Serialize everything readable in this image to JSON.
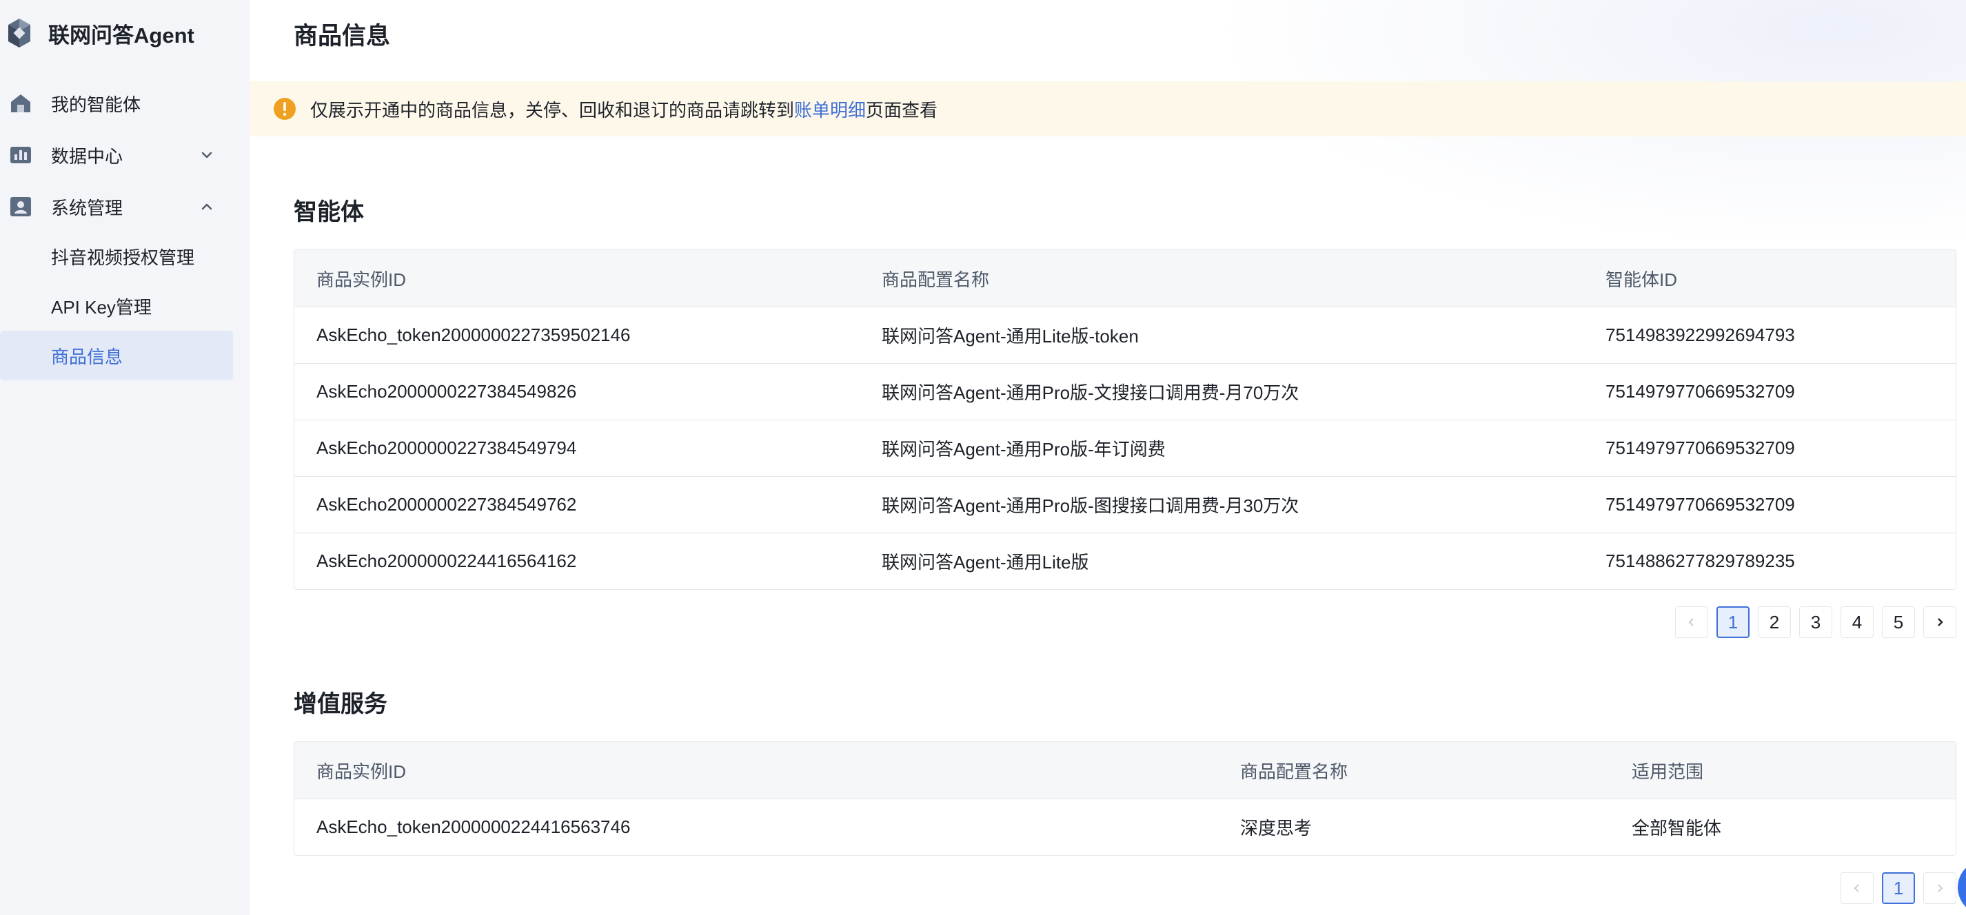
{
  "sidebar": {
    "brand": "联网问答Agent",
    "items": [
      {
        "label": "我的智能体",
        "icon": "home-icon"
      },
      {
        "label": "数据中心",
        "icon": "chart-icon"
      },
      {
        "label": "系统管理",
        "icon": "user-card-icon"
      }
    ],
    "sub_items": [
      {
        "label": "抖音视频授权管理"
      },
      {
        "label": "API Key管理"
      },
      {
        "label": "商品信息"
      }
    ]
  },
  "main": {
    "title": "商品信息",
    "notice": {
      "prefix": "仅展示开通中的商品信息，关停、回收和退订的商品请跳转到",
      "link": "账单明细",
      "suffix": "页面查看"
    },
    "agents": {
      "title": "智能体",
      "columns": [
        "商品实例ID",
        "商品配置名称",
        "智能体ID"
      ],
      "rows": [
        [
          "AskEcho_token2000000227359502146",
          "联网问答Agent-通用Lite版-token",
          "7514983922992694793"
        ],
        [
          "AskEcho2000000227384549826",
          "联网问答Agent-通用Pro版-文搜接口调用费-月70万次",
          "7514979770669532709"
        ],
        [
          "AskEcho2000000227384549794",
          "联网问答Agent-通用Pro版-年订阅费",
          "7514979770669532709"
        ],
        [
          "AskEcho2000000227384549762",
          "联网问答Agent-通用Pro版-图搜接口调用费-月30万次",
          "7514979770669532709"
        ],
        [
          "AskEcho2000000224416564162",
          "联网问答Agent-通用Lite版",
          "7514886277829789235"
        ]
      ],
      "pages": [
        "1",
        "2",
        "3",
        "4",
        "5"
      ],
      "current_page": "1"
    },
    "services": {
      "title": "增值服务",
      "columns": [
        "商品实例ID",
        "商品配置名称",
        "适用范围"
      ],
      "rows": [
        [
          "AskEcho_token2000000224416563746",
          "深度思考",
          "全部智能体"
        ]
      ],
      "pages": [
        "1"
      ],
      "current_page": "1"
    }
  },
  "colors": {
    "accent": "#3f6fd8",
    "sidebar_bg": "#f3f5f8",
    "notice_bg": "#fef8ea",
    "warning": "#f0a020"
  }
}
